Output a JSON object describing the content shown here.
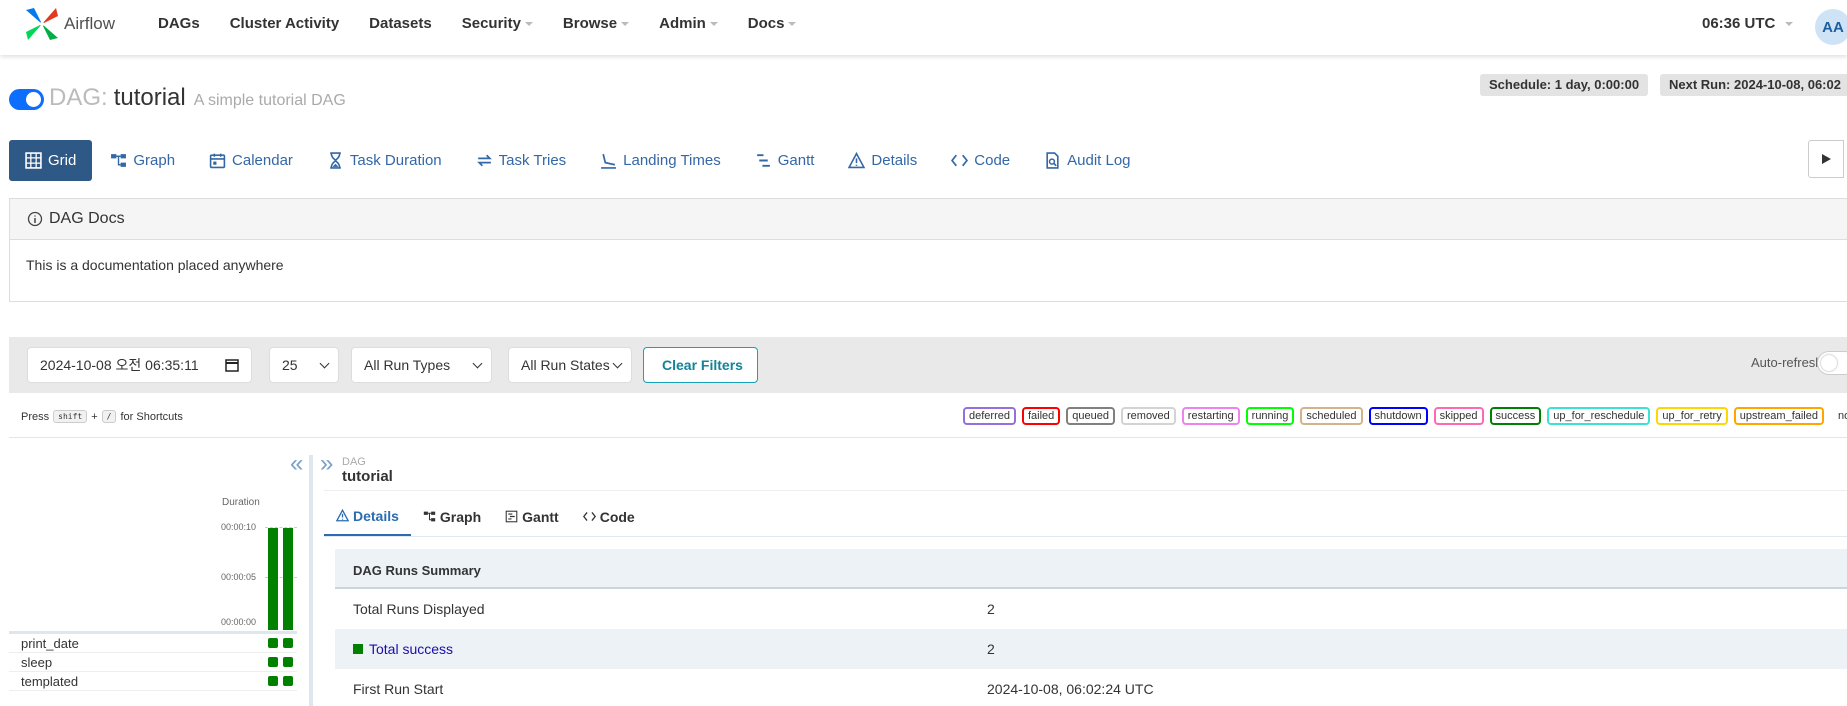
{
  "brand": {
    "name": "Airflow"
  },
  "nav": {
    "items": [
      {
        "label": "DAGs",
        "dropdown": false
      },
      {
        "label": "Cluster Activity",
        "dropdown": false
      },
      {
        "label": "Datasets",
        "dropdown": false
      },
      {
        "label": "Security",
        "dropdown": true
      },
      {
        "label": "Browse",
        "dropdown": true
      },
      {
        "label": "Admin",
        "dropdown": true
      },
      {
        "label": "Docs",
        "dropdown": true
      }
    ],
    "clock": "06:36 UTC",
    "avatar": "AA"
  },
  "dag": {
    "prefix": "DAG:",
    "id": "tutorial",
    "description": "A simple tutorial DAG",
    "schedule": "Schedule: 1 day, 0:00:00",
    "next_run": "Next Run: 2024-10-08, 06:02",
    "paused": false
  },
  "view_tabs": [
    {
      "label": "Grid",
      "icon": "grid-icon",
      "active": true
    },
    {
      "label": "Graph",
      "icon": "graph-icon",
      "active": false
    },
    {
      "label": "Calendar",
      "icon": "calendar-icon",
      "active": false
    },
    {
      "label": "Task Duration",
      "icon": "hourglass-icon",
      "active": false
    },
    {
      "label": "Task Tries",
      "icon": "retry-icon",
      "active": false
    },
    {
      "label": "Landing Times",
      "icon": "landing-icon",
      "active": false
    },
    {
      "label": "Gantt",
      "icon": "gantt-icon",
      "active": false
    },
    {
      "label": "Details",
      "icon": "warning-icon",
      "active": false
    },
    {
      "label": "Code",
      "icon": "code-icon",
      "active": false
    },
    {
      "label": "Audit Log",
      "icon": "audit-log-icon",
      "active": false
    }
  ],
  "docs": {
    "title": "DAG Docs",
    "body": "This is a documentation placed anywhere"
  },
  "filters": {
    "date": "2024-10-08 오전 06:35:11",
    "num_runs": "25",
    "run_types": "All Run Types",
    "run_states": "All Run States",
    "clear": "Clear Filters",
    "auto_refresh": "Auto-refresh"
  },
  "shortcuts": {
    "press": "Press",
    "key1": "shift",
    "plus": "+",
    "key2": "/",
    "suffix": "for Shortcuts"
  },
  "legend": [
    {
      "label": "deferred",
      "color": "#9370db"
    },
    {
      "label": "failed",
      "color": "#ff0000"
    },
    {
      "label": "queued",
      "color": "#808080"
    },
    {
      "label": "removed",
      "color": "#d3d3d3"
    },
    {
      "label": "restarting",
      "color": "#ee82ee"
    },
    {
      "label": "running",
      "color": "#00ff00"
    },
    {
      "label": "scheduled",
      "color": "#d2b48c"
    },
    {
      "label": "shutdown",
      "color": "#0000ff"
    },
    {
      "label": "skipped",
      "color": "#ff69b4"
    },
    {
      "label": "success",
      "color": "#008000"
    },
    {
      "label": "up_for_reschedule",
      "color": "#40e0d0"
    },
    {
      "label": "up_for_retry",
      "color": "#ffd700"
    },
    {
      "label": "upstream_failed",
      "color": "#ffa500"
    },
    {
      "label": "no_status",
      "color": "transparent"
    }
  ],
  "grid": {
    "duration_label": "Duration",
    "ticks": [
      "00:00:10",
      "00:00:05",
      "00:00:00"
    ],
    "runs": [
      {
        "duration_sec": 10,
        "state": "success"
      },
      {
        "duration_sec": 10,
        "state": "success"
      }
    ],
    "tasks": [
      "print_date",
      "sleep",
      "templated"
    ]
  },
  "details": {
    "crumb_label": "DAG",
    "crumb_value": "tutorial",
    "tabs": [
      {
        "label": "Details",
        "icon": "warning-icon",
        "active": true
      },
      {
        "label": "Graph",
        "icon": "graph-icon",
        "active": false
      },
      {
        "label": "Gantt",
        "icon": "gantt-icon",
        "active": false
      },
      {
        "label": "Code",
        "icon": "code-icon",
        "active": false
      }
    ],
    "summary_title": "DAG Runs Summary",
    "rows": [
      {
        "key": "Total Runs Displayed",
        "value": "2"
      },
      {
        "key": "Total success",
        "value": "2"
      },
      {
        "key": "First Run Start",
        "value": "2024-10-08, 06:02:24 UTC"
      }
    ]
  },
  "colors": {
    "accent": "#2e5886",
    "success": "#028000",
    "link": "#3367a6"
  }
}
